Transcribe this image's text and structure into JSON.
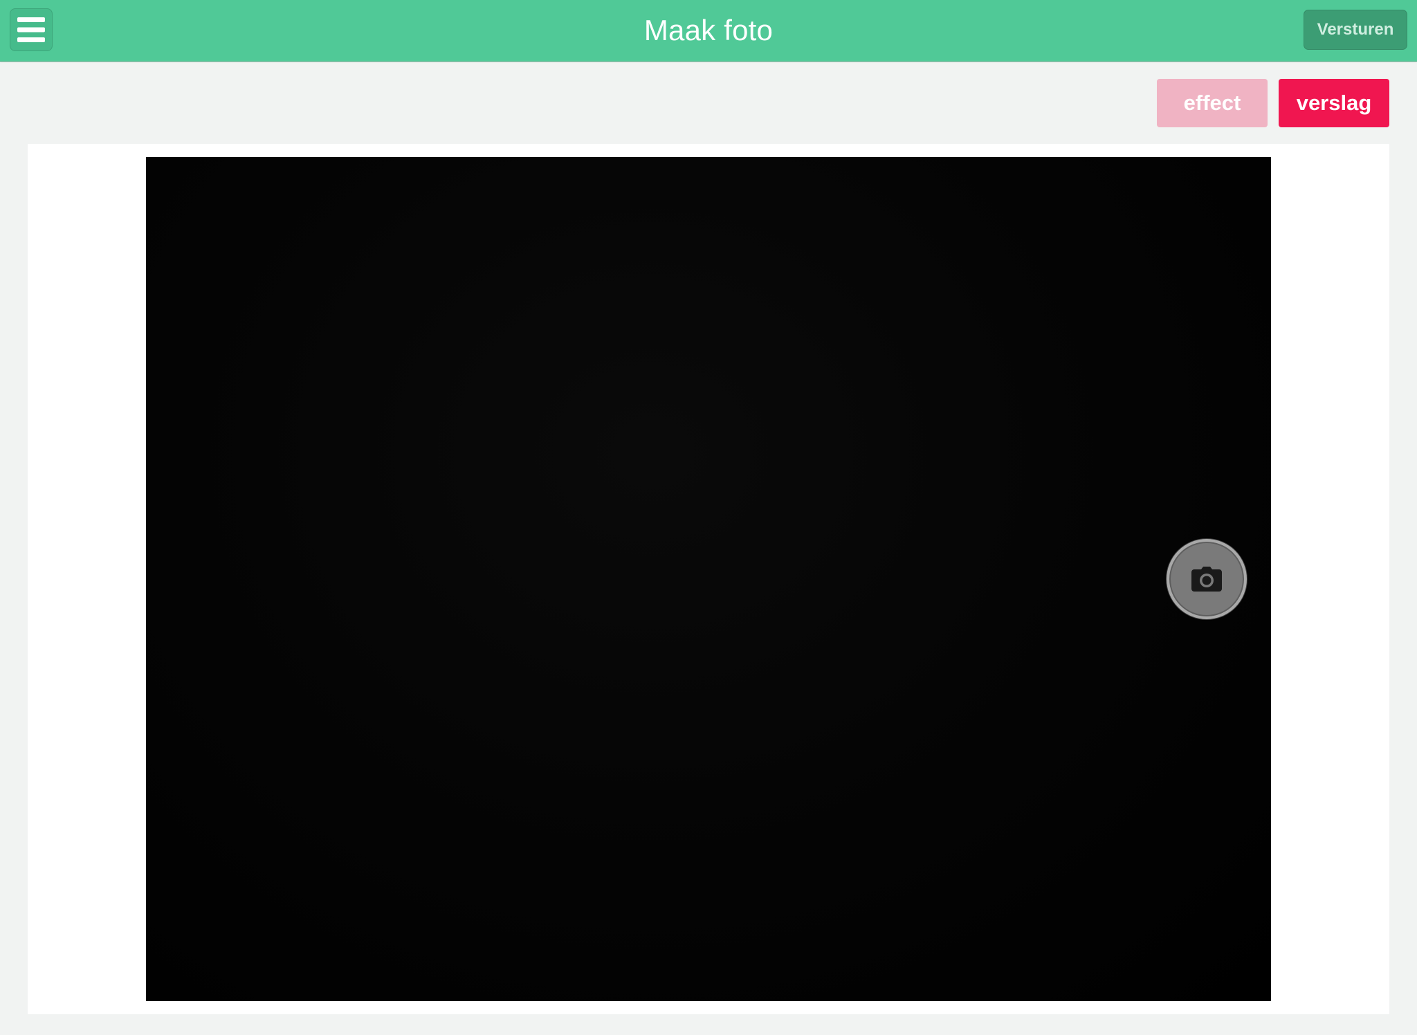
{
  "header": {
    "title": "Maak foto",
    "send_label": "Versturen",
    "menu_icon": "hamburger-menu-icon",
    "background_color": "#50c997"
  },
  "actions": {
    "effect_label": "effect",
    "verslag_label": "verslag",
    "effect_color": "#f0b3c3",
    "verslag_color": "#f01650"
  },
  "camera": {
    "shutter_icon": "camera-icon"
  }
}
